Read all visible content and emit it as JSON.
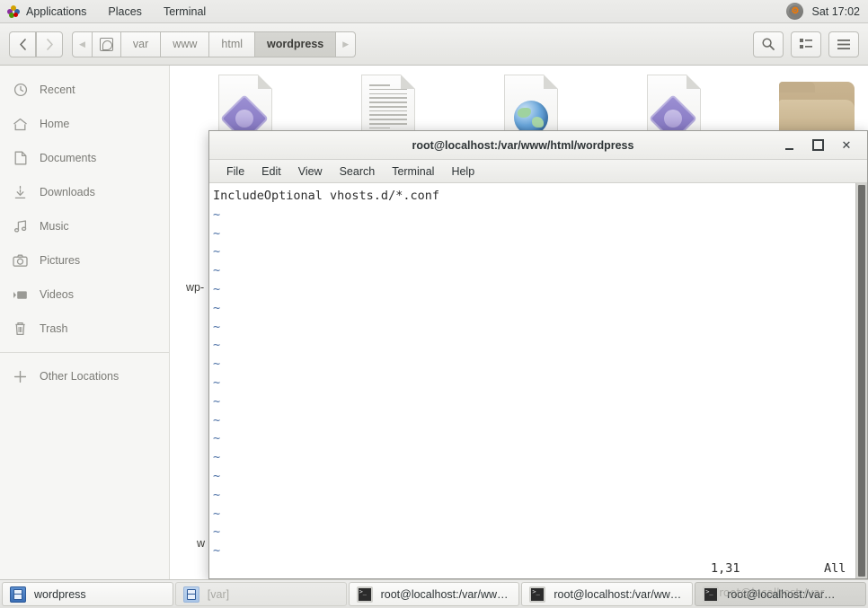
{
  "top_panel": {
    "applications": "Applications",
    "places": "Places",
    "terminal": "Terminal",
    "clock": "Sat 17:02",
    "tray_icon": "system-update-icon"
  },
  "file_manager": {
    "toolbar": {
      "back_icon": "chevron-left-icon",
      "forward_icon": "chevron-right-icon",
      "prev_crumb_icon": "triangle-left-icon",
      "next_crumb_icon": "triangle-right-icon",
      "device_icon": "filesystem-device-icon",
      "search_icon": "search-icon",
      "view_icon": "list-view-icon",
      "menu_icon": "hamburger-menu-icon"
    },
    "breadcrumb": [
      "var",
      "www",
      "html",
      "wordpress"
    ],
    "breadcrumb_active": "wordpress",
    "sidebar": [
      {
        "label": "Recent",
        "icon": "clock-icon"
      },
      {
        "label": "Home",
        "icon": "home-icon"
      },
      {
        "label": "Documents",
        "icon": "document-icon"
      },
      {
        "label": "Downloads",
        "icon": "download-icon"
      },
      {
        "label": "Music",
        "icon": "music-note-icon"
      },
      {
        "label": "Pictures",
        "icon": "camera-icon"
      },
      {
        "label": "Videos",
        "icon": "video-icon"
      },
      {
        "label": "Trash",
        "icon": "trash-icon"
      }
    ],
    "sidebar_other": {
      "label": "Other Locations",
      "icon": "plus-icon"
    },
    "files": [
      {
        "icon": "php-file-icon",
        "label": ""
      },
      {
        "icon": "text-file-icon",
        "label": ""
      },
      {
        "icon": "html-file-icon",
        "label": ""
      },
      {
        "icon": "php-file-icon",
        "label": ""
      },
      {
        "icon": "folder-icon",
        "label": ""
      }
    ],
    "partial_labels": {
      "one": "wp-",
      "two": "w"
    }
  },
  "terminal_window": {
    "title": "root@localhost:/var/www/html/wordpress",
    "menu": [
      "File",
      "Edit",
      "View",
      "Search",
      "Terminal",
      "Help"
    ],
    "window_buttons": {
      "minimize": "minimize-icon",
      "maximize": "maximize-icon",
      "close": "close-icon"
    },
    "content_first_line": "IncludeOptional vhosts.d/*.conf",
    "empty_line_marker": "~",
    "empty_line_count": 19,
    "status_position": "1,31",
    "status_scroll": "All"
  },
  "taskbar": [
    {
      "label": "wordpress",
      "icon": "files-icon",
      "state": "normal"
    },
    {
      "label": "[var]",
      "icon": "files-icon",
      "state": "dim"
    },
    {
      "label": "root@localhost:/var/ww…",
      "icon": "terminal-icon",
      "state": "normal"
    },
    {
      "label": "root@localhost:/var/ww…",
      "icon": "terminal-icon",
      "state": "normal"
    },
    {
      "label": "root@localhost:/var…",
      "icon": "terminal-icon",
      "state": "pressed",
      "watermark": "root@localhost:/var"
    }
  ]
}
